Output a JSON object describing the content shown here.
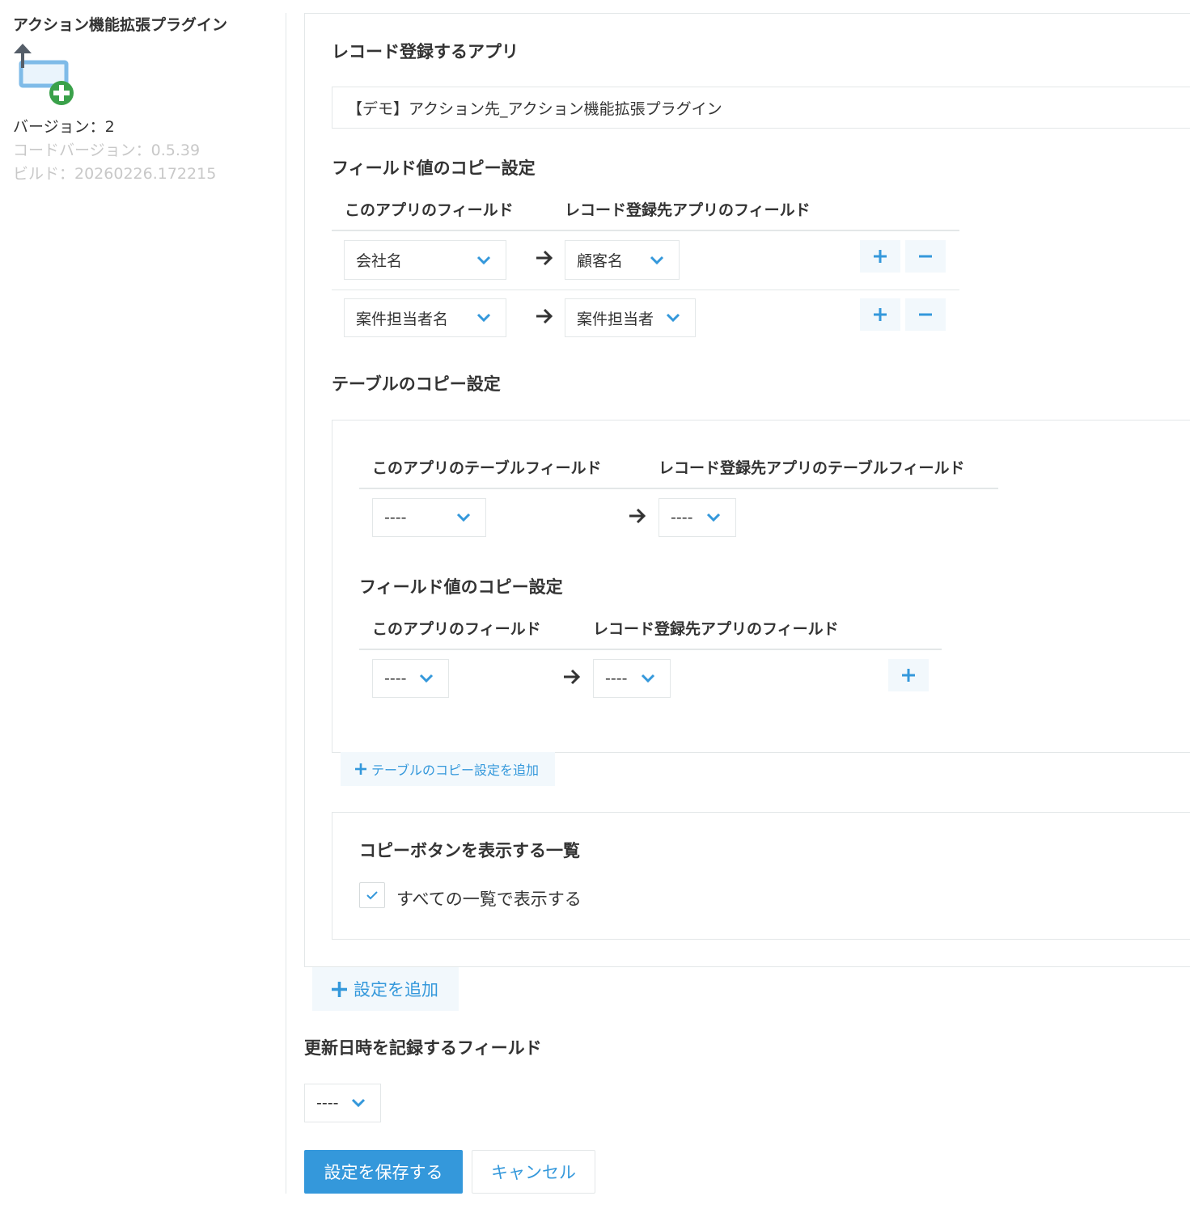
{
  "sidebar": {
    "plugin_name": "アクション機能拡張プラグイン",
    "plugin_icon": "record-add-icon",
    "version": "バージョン：2",
    "code_version": "コードバージョン：0.5.39",
    "build": "ビルド：20260226.172215"
  },
  "main": {
    "target_app": {
      "title": "レコード登録するアプリ",
      "value": "【デモ】アクション先_アクション機能拡張プラグイン"
    },
    "field_copy": {
      "title": "フィールド値のコピー設定",
      "col_source": "このアプリのフィールド",
      "col_dest": "レコード登録先アプリのフィールド",
      "rows": [
        {
          "source": "会社名",
          "dest": "顧客名"
        },
        {
          "source": "案件担当者名",
          "dest": "案件担当者"
        }
      ]
    },
    "table_copy": {
      "title": "テーブルのコピー設定",
      "col_source_table": "このアプリのテーブルフィールド",
      "col_dest_table": "レコード登録先アプリのテーブルフィールド",
      "source_table_value": "----",
      "dest_table_value": "----",
      "inner_title": "フィールド値のコピー設定",
      "inner_col_source": "このアプリのフィールド",
      "inner_col_dest": "レコード登録先アプリのフィールド",
      "inner_source_value": "----",
      "inner_dest_value": "----",
      "add_label": "テーブルのコピー設定を追加"
    },
    "views": {
      "title": "コピーボタンを表示する一覧",
      "checkbox_label": "すべての一覧で表示する",
      "checked": true
    },
    "add_setting_label": "設定を追加",
    "timestamp_field": {
      "title": "更新日時を記録するフィールド",
      "value": "----"
    },
    "save_label": "設定を保存する",
    "cancel_label": "キャンセル"
  },
  "colors": {
    "accent": "#3498db",
    "button_bg": "#f2f8fc",
    "border": "#e3e7e8",
    "muted_text": "#c8c8c8",
    "icon_green": "#3aa14a"
  }
}
